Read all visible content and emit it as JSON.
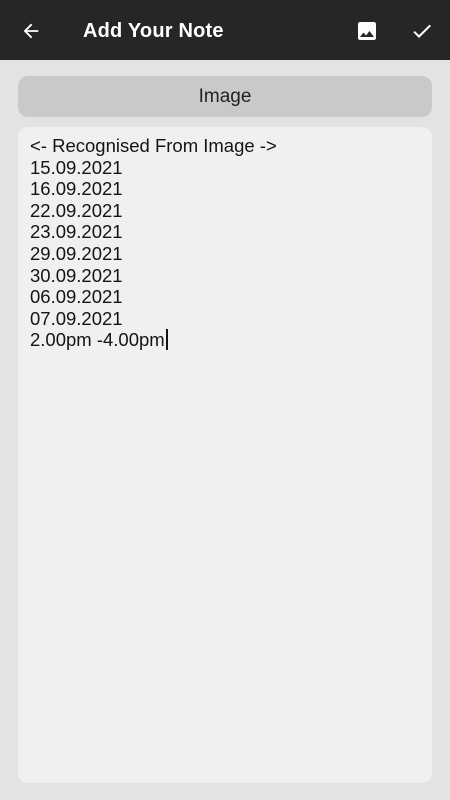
{
  "toolbar": {
    "title": "Add Your Note",
    "back_icon": "arrow-left-icon",
    "image_icon": "image-icon",
    "confirm_icon": "check-icon",
    "background": "#262626",
    "text_color": "#ffffff"
  },
  "image_button": {
    "label": "Image"
  },
  "note": {
    "lines": [
      "<- Recognised From Image ->",
      "15.09.2021",
      "16.09.2021",
      "22.09.2021",
      "23.09.2021",
      "29.09.2021",
      "30.09.2021",
      "06.09.2021",
      "07.09.2021",
      "2.00pm -4.00pm"
    ]
  },
  "colors": {
    "page_background": "#e3e3e3",
    "button_background": "#c9c9c9",
    "note_background": "#f0f0f0"
  }
}
